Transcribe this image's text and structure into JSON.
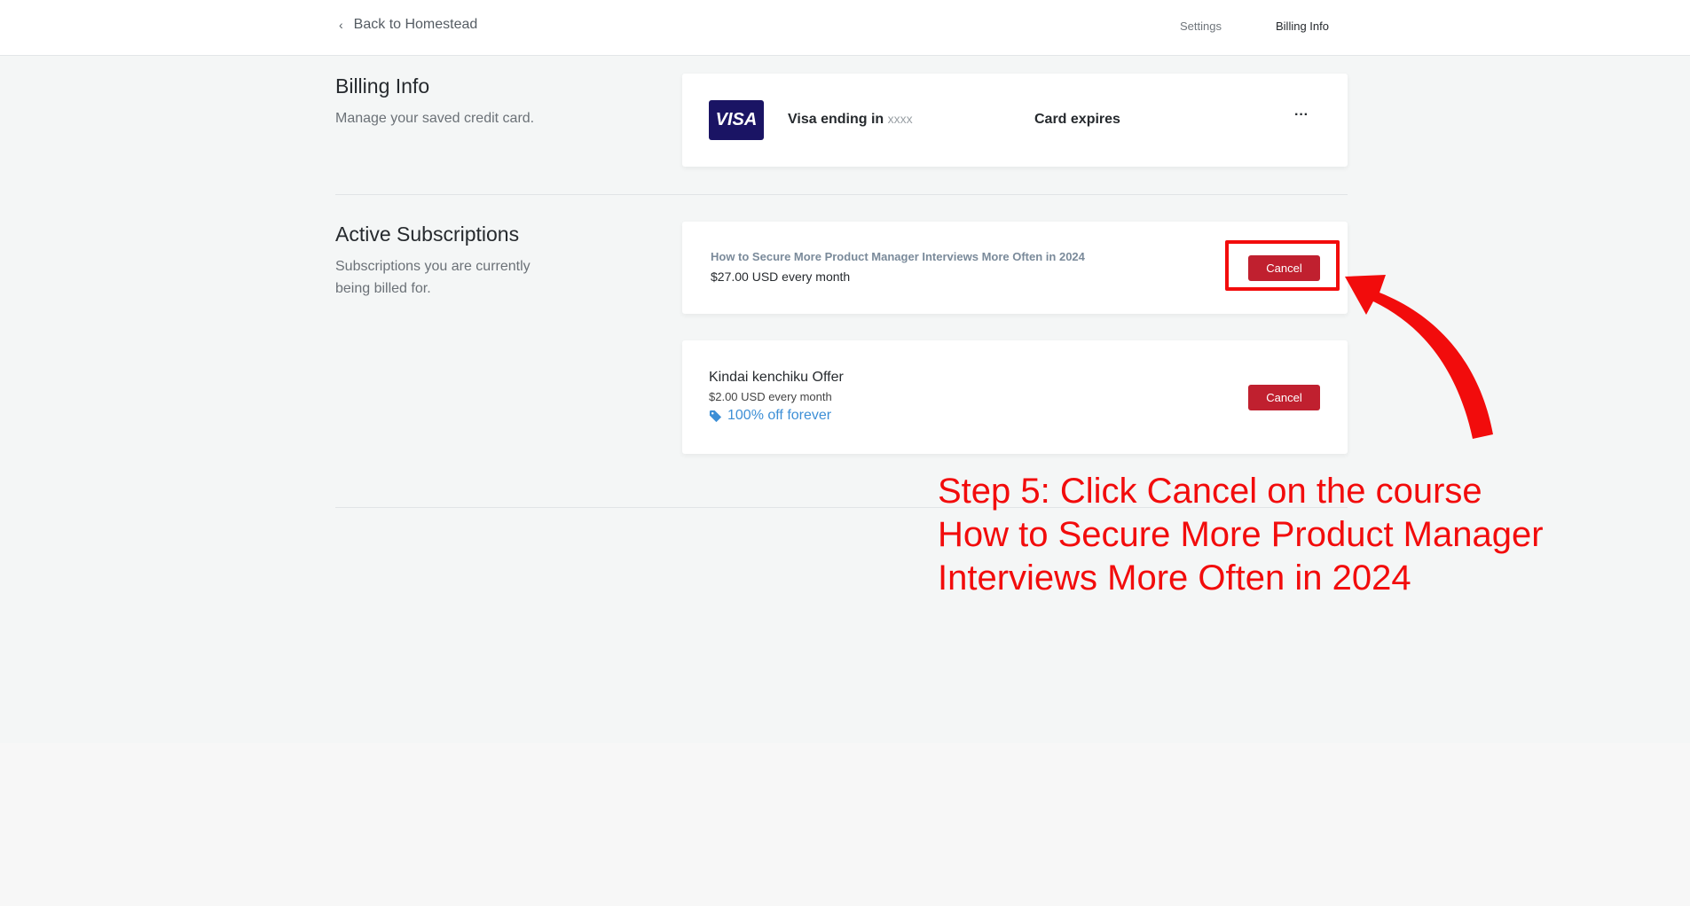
{
  "header": {
    "back_label": "Back to Homestead",
    "nav": [
      {
        "label": "Settings"
      },
      {
        "label": "Billing Info"
      }
    ]
  },
  "billing": {
    "title": "Billing Info",
    "subtitle": "Manage your saved credit card.",
    "card": {
      "brand": "VISA",
      "ending_label": "Visa ending in",
      "ending_value": "xxxx",
      "expires_label": "Card expires",
      "menu": "···"
    }
  },
  "subscriptions": {
    "title": "Active Subscriptions",
    "subtitle_1": "Subscriptions you are currently",
    "subtitle_2": "being billed for.",
    "items": [
      {
        "name": "How to Secure More Product Manager Interviews More Often in 2024",
        "price": "$27.00 USD every month",
        "cancel": "Cancel"
      },
      {
        "name": "Kindai kenchiku Offer",
        "price": "$2.00 USD every month",
        "discount": "100% off forever",
        "cancel": "Cancel"
      }
    ]
  },
  "annotation": {
    "lines": [
      "Step 5: Click Cancel on the course",
      "How to Secure More Product Manager",
      "Interviews More Often in 2024"
    ],
    "color": "#f20c0c"
  },
  "colors": {
    "cancel": "#c0202f",
    "visa": "#1a1464",
    "discount": "#3d8fd6"
  }
}
